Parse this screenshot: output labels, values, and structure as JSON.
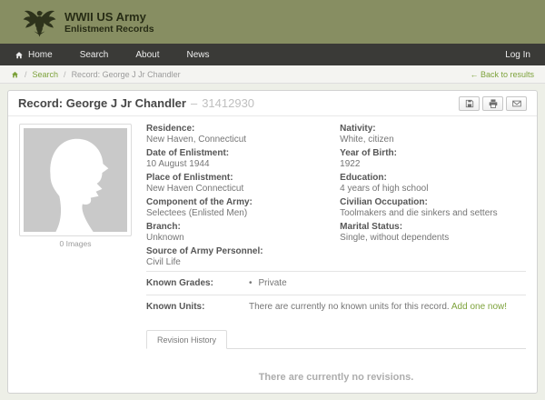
{
  "brand": {
    "title": "WWII US Army",
    "subtitle": "Enlistment Records"
  },
  "nav": {
    "home": "Home",
    "search": "Search",
    "about": "About",
    "news": "News",
    "login": "Log In"
  },
  "breadcrumb": {
    "sep": "/",
    "search": "Search",
    "current": "Record: George J Jr Chandler",
    "back_arrow": "←",
    "back": "Back to results"
  },
  "record": {
    "title": "Record: George J Jr Chandler",
    "dash": "–",
    "serial": "31412930",
    "images_caption": "0 Images",
    "fields_left": [
      {
        "label": "Residence:",
        "value": "New Haven, Connecticut"
      },
      {
        "label": "Date of Enlistment:",
        "value": "10 August 1944"
      },
      {
        "label": "Place of Enlistment:",
        "value": "New Haven Connecticut"
      },
      {
        "label": "Component of the Army:",
        "value": "Selectees (Enlisted Men)"
      },
      {
        "label": "Branch:",
        "value": "Unknown"
      },
      {
        "label": "Source of Army Personnel:",
        "value": "Civil Life"
      }
    ],
    "fields_right": [
      {
        "label": "Nativity:",
        "value": "White, citizen"
      },
      {
        "label": "Year of Birth:",
        "value": "1922"
      },
      {
        "label": "Education:",
        "value": "4 years of high school"
      },
      {
        "label": "Civilian Occupation:",
        "value": "Toolmakers and die sinkers and setters"
      },
      {
        "label": "Marital Status:",
        "value": "Single, without dependents"
      }
    ],
    "grades": {
      "label": "Known Grades:",
      "value": "Private"
    },
    "units": {
      "label": "Known Units:",
      "text": "There are currently no known units for this record.",
      "link": "Add one now!"
    },
    "tab": "Revision History",
    "empty": "There are currently no revisions."
  },
  "icons": {
    "logo": "us-army-eagle-seal",
    "home": "house-icon",
    "save": "save-icon",
    "print": "printer-icon",
    "email": "envelope-icon",
    "soldier": "soldier-silhouette"
  },
  "colors": {
    "header_bg": "#878E62",
    "nav_bg": "#3A3A37",
    "accent_green": "#7DA23B",
    "page_bg": "#EDEFE7",
    "card_border": "#D2D2D2",
    "placeholder_gray": "#C9C9C9"
  }
}
